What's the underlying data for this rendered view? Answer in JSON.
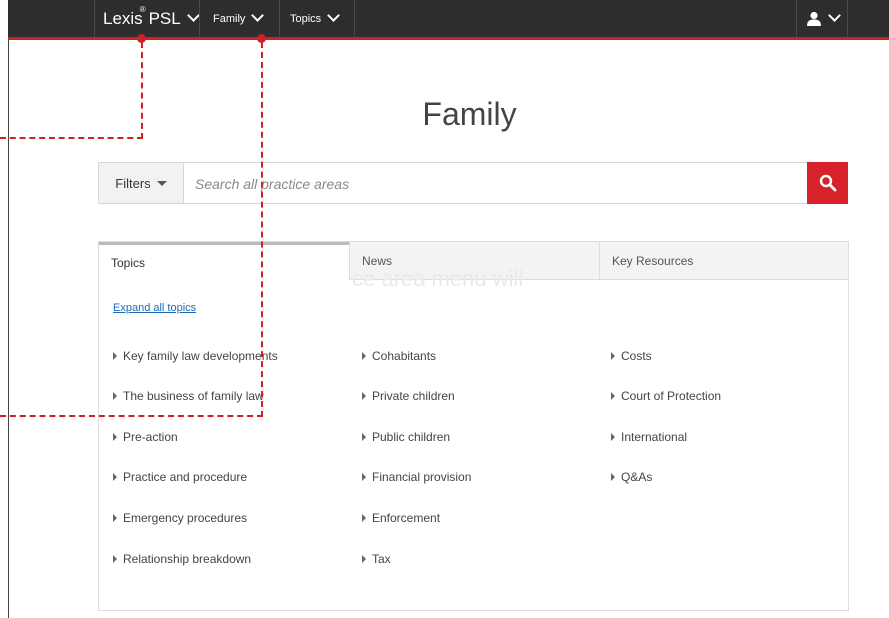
{
  "header": {
    "brand": "Lexis",
    "brand_mark": "®",
    "product": "PSL",
    "nav": [
      {
        "label": "Family"
      },
      {
        "label": "Topics"
      }
    ]
  },
  "page_title": "Family",
  "search": {
    "filters_label": "Filters",
    "placeholder": "Search all practice areas"
  },
  "tabs": [
    {
      "label": "Topics",
      "active": true
    },
    {
      "label": "News",
      "active": false
    },
    {
      "label": "Key Resources",
      "active": false
    }
  ],
  "expand_link": "Expand all topics",
  "columns": [
    [
      "Key family law developments",
      "The business of family law",
      "Pre-action",
      "Practice and procedure",
      "Emergency procedures",
      "Relationship breakdown"
    ],
    [
      "Cohabitants",
      "Private children",
      "Public children",
      "Financial provision",
      "Enforcement",
      "Tax"
    ],
    [
      "Costs",
      "Court of Protection",
      "International",
      "Q&As"
    ]
  ],
  "faint_overlay_text": "ce area menu will",
  "colors": {
    "accent": "#cc2227",
    "topbar": "#2d2d2d",
    "link": "#1a6bc0"
  },
  "icons": {
    "search": "search-icon",
    "user": "user-icon"
  }
}
